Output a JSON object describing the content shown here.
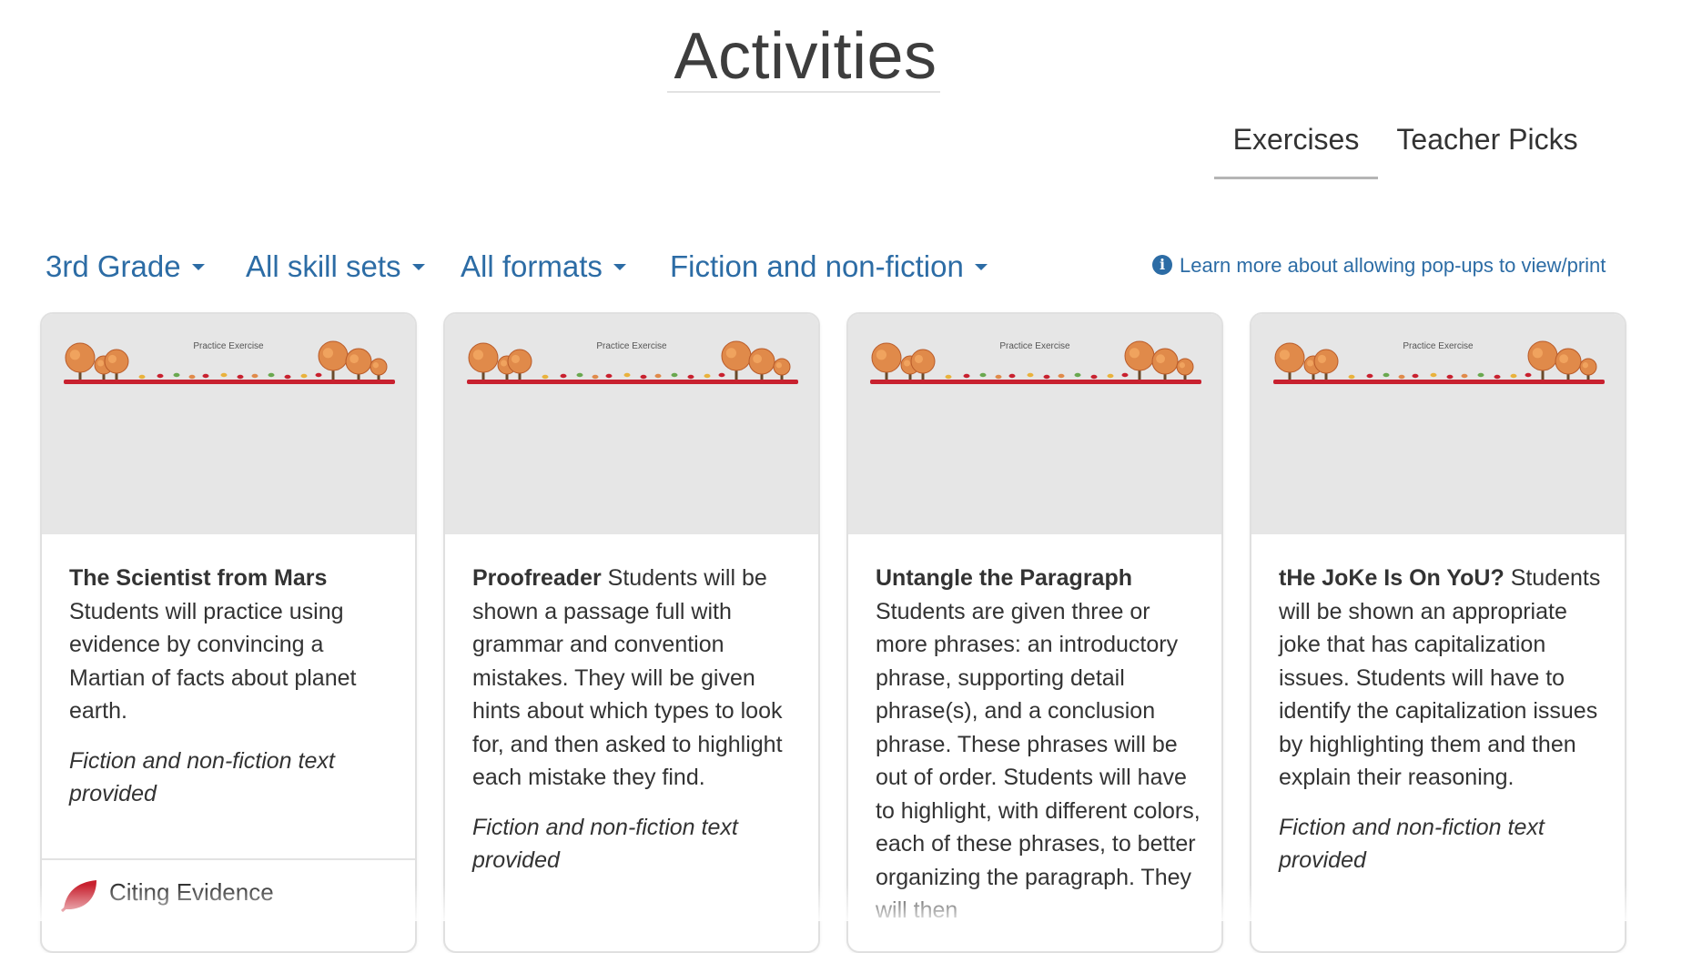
{
  "page": {
    "title": "Activities"
  },
  "tabs": [
    {
      "label": "Exercises",
      "active": true
    },
    {
      "label": "Teacher Picks",
      "active": false
    }
  ],
  "filters": [
    {
      "label": "3rd Grade"
    },
    {
      "label": "All skill sets"
    },
    {
      "label": "All formats"
    },
    {
      "label": "Fiction and non-fiction"
    }
  ],
  "popup_link": {
    "label": "Learn more about allowing pop-ups to view/print",
    "icon": "info-icon"
  },
  "thumbnail_caption": "Practice Exercise",
  "cards": [
    {
      "title": "The Scientist from Mars",
      "description": "Students will practice using evidence by convincing a Martian of facts about planet earth.",
      "meta": "Fiction and non-fiction text provided",
      "skill": "Citing Evidence"
    },
    {
      "title": "Proofreader",
      "description": "Students will be shown a passage full with grammar and convention mistakes. They will be given hints about which types to look for, and then asked to highlight each mistake they find.",
      "meta": "Fiction and non-fiction text provided"
    },
    {
      "title": "Untangle the Paragraph",
      "description": "Students are given three or more phrases: an introductory phrase, supporting detail phrase(s), and a conclusion phrase. These phrases will be out of order. Students will have to highlight, with different colors, each of these phrases, to better organizing the paragraph. They will then",
      "meta": ""
    },
    {
      "title": "tHe JoKe Is On YoU?",
      "description": "Students will be shown an appropriate joke that has capitalization issues. Students will have to identify the capitalization issues by highlighting them and then explain their reasoning.",
      "meta": "Fiction and non-fiction text provided"
    }
  ],
  "colors": {
    "link_blue": "#2c6ca5",
    "leaf_red": "#c8212f",
    "thumb_gray": "#e6e6e6"
  }
}
